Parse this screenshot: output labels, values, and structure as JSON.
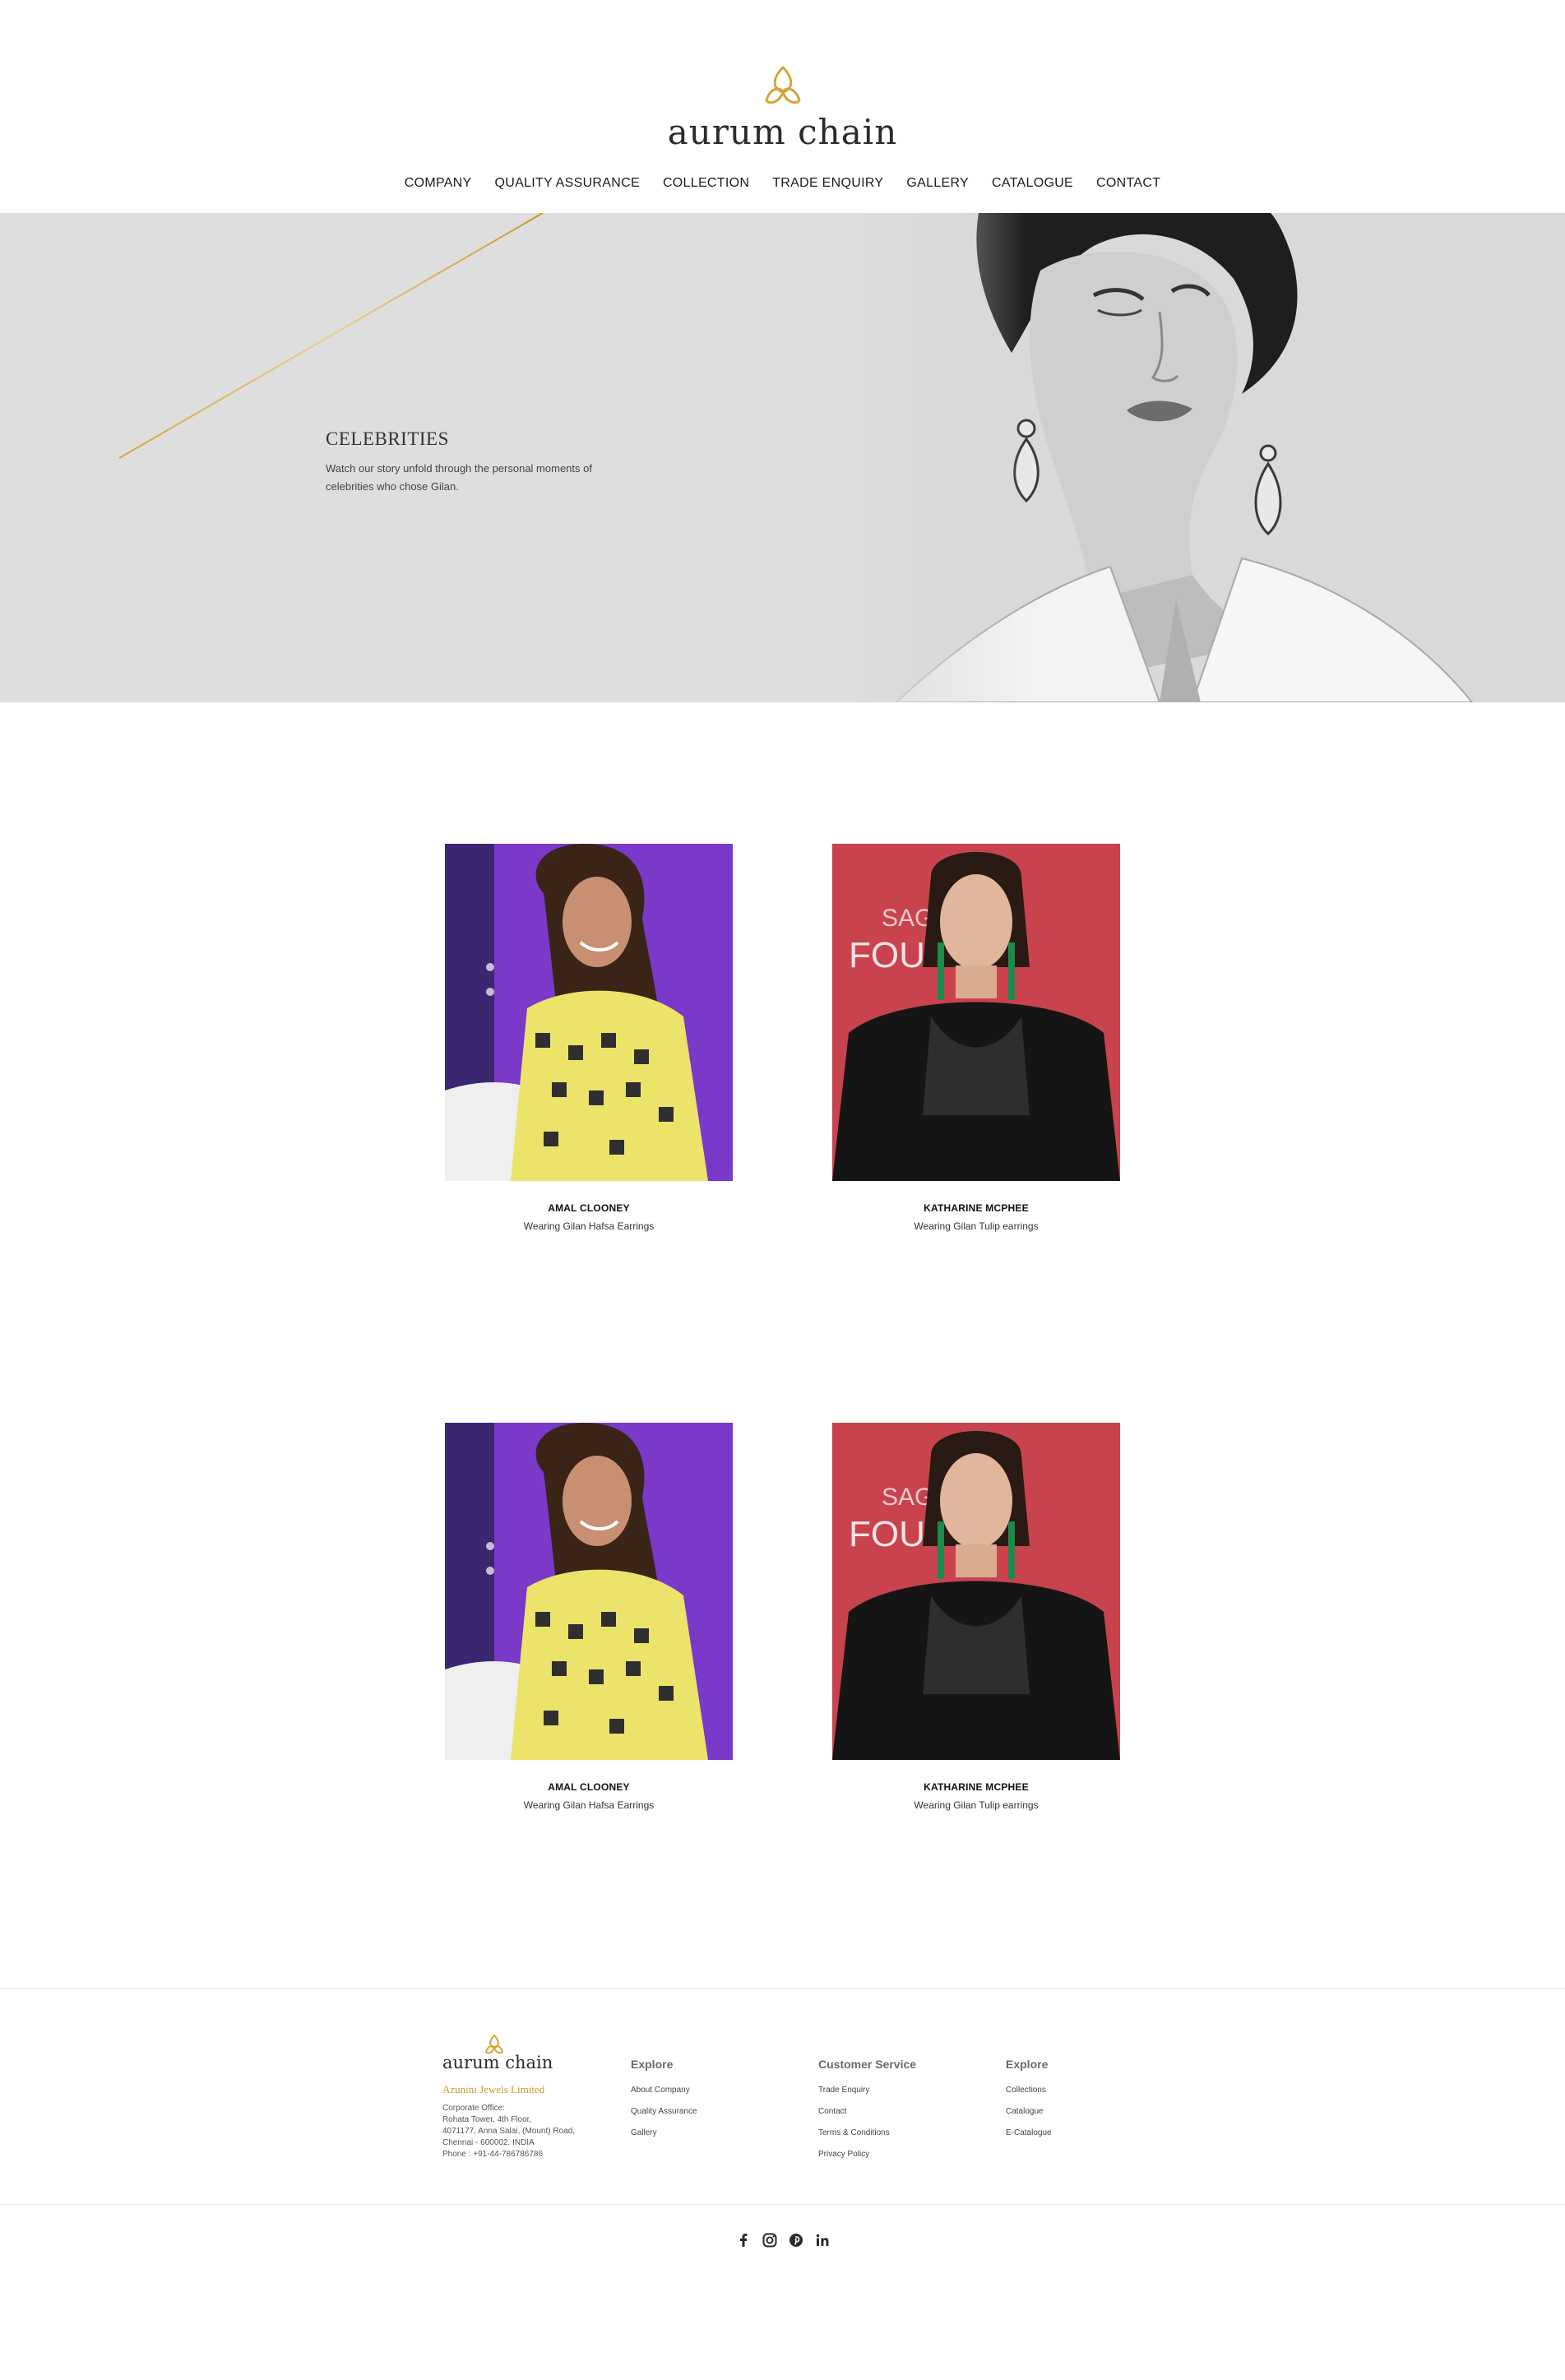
{
  "brand": {
    "name": "aurum chain",
    "accent_color": "#d4a53a"
  },
  "nav": {
    "items": [
      {
        "label": "COMPANY"
      },
      {
        "label": "QUALITY ASSURANCE"
      },
      {
        "label": "COLLECTION"
      },
      {
        "label": "TRADE ENQUIRY"
      },
      {
        "label": "GALLERY"
      },
      {
        "label": "CATALOGUE"
      },
      {
        "label": "CONTACT"
      }
    ]
  },
  "hero": {
    "title": "CELEBRITIES",
    "description": "Watch our story unfold through the personal moments of celebrities who chose Gilan."
  },
  "gallery": {
    "cards": [
      {
        "name": "AMAL CLOONEY",
        "caption": "Wearing Gilan Hafsa Earrings"
      },
      {
        "name": "KATHARINE MCPHEE",
        "caption": "Wearing Gilan Tulip earrings"
      },
      {
        "name": "AMAL CLOONEY",
        "caption": "Wearing Gilan Hafsa Earrings"
      },
      {
        "name": "KATHARINE MCPHEE",
        "caption": "Wearing Gilan Tulip earrings"
      }
    ]
  },
  "footer": {
    "logo_text": "aurum chain",
    "company_name": "Azunini Jewels Limited",
    "address": {
      "line1": "Corporate Office:",
      "line2": "Rohata Tower, 4th Floor,",
      "line3": "4071177, Anna Salai, (Mount) Road,",
      "line4": "Chennai - 600002. INDIA",
      "line5": "Phone : +91-44-786786786"
    },
    "col1": {
      "heading": "Explore",
      "links": [
        "About Company",
        "Quality Assurance",
        "Gallery"
      ]
    },
    "col2": {
      "heading": "Customer Service",
      "links": [
        "Trade Enquiry",
        "Contact",
        "Terms & Conditions",
        "Privacy Policy"
      ]
    },
    "col3": {
      "heading": "Explore",
      "links": [
        "Collections",
        "Catalogue",
        "E-Catalogue"
      ]
    },
    "social": [
      "facebook-icon",
      "instagram-icon",
      "pinterest-icon",
      "linkedin-icon"
    ]
  }
}
